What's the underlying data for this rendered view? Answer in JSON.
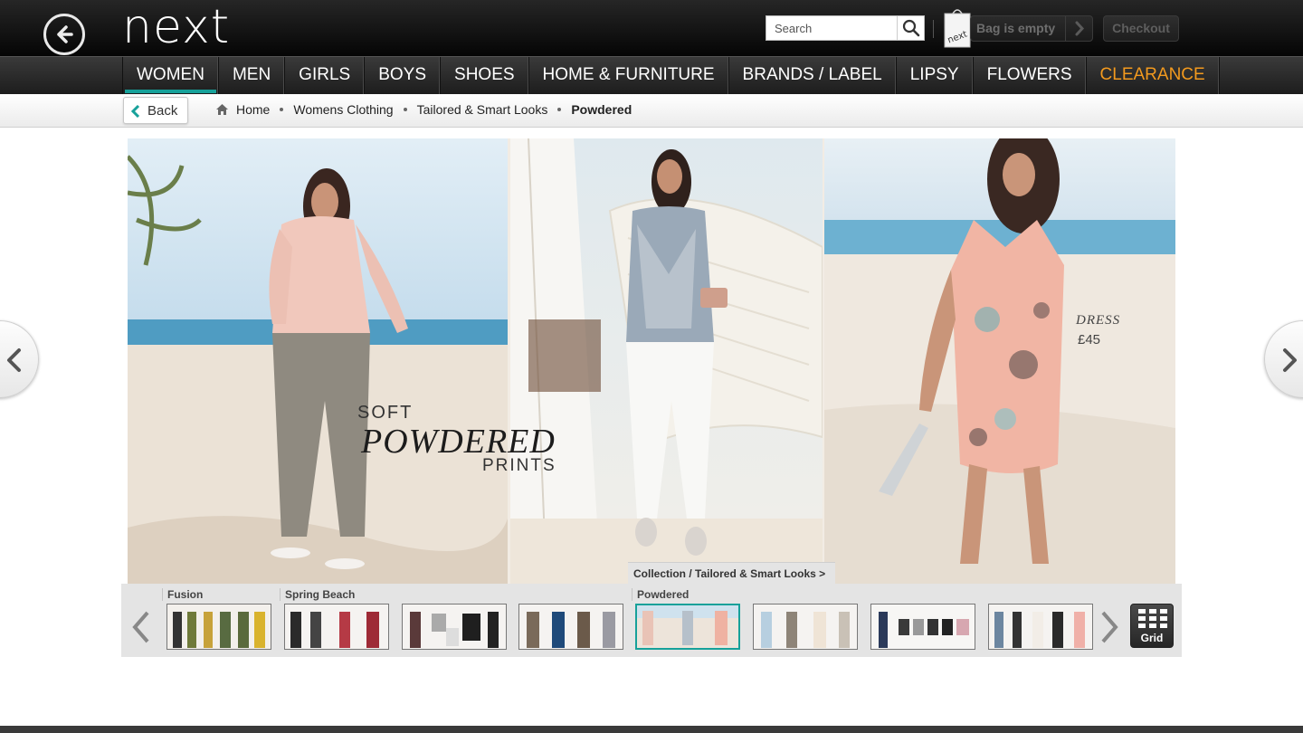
{
  "header": {
    "logo": "next",
    "search_placeholder": "Search",
    "bag_label": "Bag is empty",
    "bag_brand": "next",
    "checkout_label": "Checkout"
  },
  "nav": {
    "items": [
      "WOMEN",
      "MEN",
      "GIRLS",
      "BOYS",
      "SHOES",
      "HOME & FURNITURE",
      "BRANDS / LABEL",
      "LIPSY",
      "FLOWERS",
      "CLEARANCE"
    ],
    "active": "WOMEN",
    "highlight": "CLEARANCE",
    "highlight_color": "#f39a1e",
    "active_color": "#17a19a"
  },
  "breadcrumb": {
    "back_label": "Back",
    "items": [
      "Home",
      "Womens Clothing",
      "Tailored & Smart Looks",
      "Powdered"
    ]
  },
  "hero": {
    "caption_soft": "SOFT",
    "caption_powdered": "POWDERED",
    "caption_prints": "PRINTS",
    "dress_label": "DRESS",
    "dress_price": "£45"
  },
  "carousel": {
    "collection_tag": "Collection / Tailored & Smart Looks >",
    "groups": [
      "Fusion",
      "Spring Beach",
      "Powdered"
    ],
    "grid_label": "Grid"
  }
}
